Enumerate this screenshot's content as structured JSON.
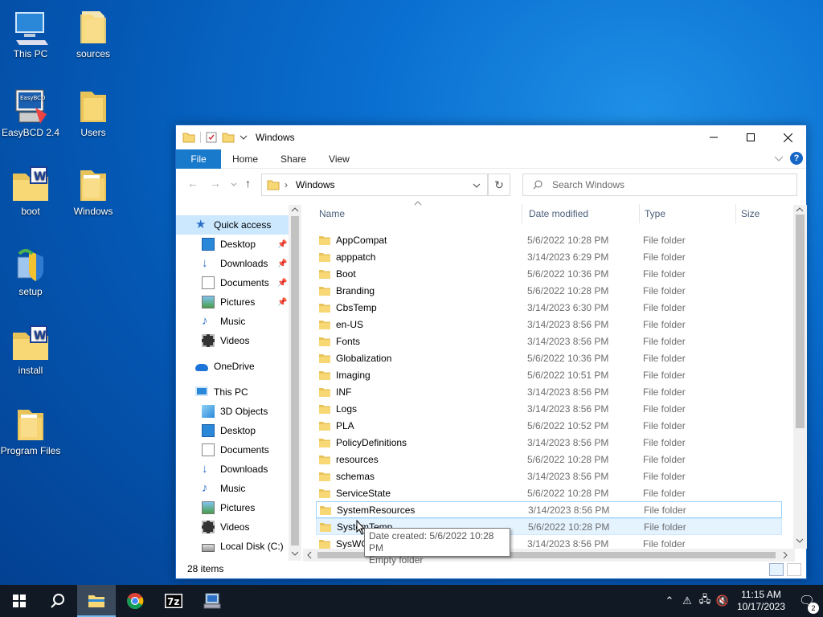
{
  "desktop": {
    "icons": [
      {
        "label": "This PC",
        "icon": "computer-icon"
      },
      {
        "label": "sources",
        "icon": "folder-icon"
      },
      {
        "label": "EasyBCD 2.4",
        "icon": "easybcd-icon"
      },
      {
        "label": "Users",
        "icon": "folder-icon"
      },
      {
        "label": "boot",
        "icon": "wim-folder-icon"
      },
      {
        "label": "Windows",
        "icon": "folder-icon"
      },
      {
        "label": "setup",
        "icon": "setup-icon"
      },
      {
        "label": "install",
        "icon": "wim-folder-icon"
      },
      {
        "label": "Program Files",
        "icon": "folder-icon"
      }
    ],
    "easybcd_badge": "EasyBCD",
    "wim_letter": "W"
  },
  "window": {
    "title": "Windows",
    "ribbon": {
      "file": "File",
      "home": "Home",
      "share": "Share",
      "view": "View",
      "help": "?"
    },
    "address": {
      "path": "Windows",
      "separator": "›"
    },
    "search": {
      "placeholder": "Search Windows"
    },
    "nav": {
      "quick_access": "Quick access",
      "quick_items": [
        "Desktop",
        "Downloads",
        "Documents",
        "Pictures",
        "Music",
        "Videos"
      ],
      "onedrive": "OneDrive",
      "this_pc": "This PC",
      "pc_items": [
        "3D Objects",
        "Desktop",
        "Documents",
        "Downloads",
        "Music",
        "Pictures",
        "Videos",
        "Local Disk (C:)"
      ]
    },
    "columns": {
      "name": "Name",
      "date": "Date modified",
      "type": "Type",
      "size": "Size"
    },
    "files": [
      {
        "name": "AppCompat",
        "date": "5/6/2022 10:28 PM",
        "type": "File folder"
      },
      {
        "name": "apppatch",
        "date": "3/14/2023 6:29 PM",
        "type": "File folder"
      },
      {
        "name": "Boot",
        "date": "5/6/2022 10:36 PM",
        "type": "File folder"
      },
      {
        "name": "Branding",
        "date": "5/6/2022 10:28 PM",
        "type": "File folder"
      },
      {
        "name": "CbsTemp",
        "date": "3/14/2023 6:30 PM",
        "type": "File folder"
      },
      {
        "name": "en-US",
        "date": "3/14/2023 8:56 PM",
        "type": "File folder"
      },
      {
        "name": "Fonts",
        "date": "3/14/2023 8:56 PM",
        "type": "File folder"
      },
      {
        "name": "Globalization",
        "date": "5/6/2022 10:36 PM",
        "type": "File folder"
      },
      {
        "name": "Imaging",
        "date": "5/6/2022 10:51 PM",
        "type": "File folder"
      },
      {
        "name": "INF",
        "date": "3/14/2023 8:56 PM",
        "type": "File folder"
      },
      {
        "name": "Logs",
        "date": "3/14/2023 8:56 PM",
        "type": "File folder"
      },
      {
        "name": "PLA",
        "date": "5/6/2022 10:52 PM",
        "type": "File folder"
      },
      {
        "name": "PolicyDefinitions",
        "date": "3/14/2023 8:56 PM",
        "type": "File folder"
      },
      {
        "name": "resources",
        "date": "5/6/2022 10:28 PM",
        "type": "File folder"
      },
      {
        "name": "schemas",
        "date": "3/14/2023 8:56 PM",
        "type": "File folder"
      },
      {
        "name": "ServiceState",
        "date": "5/6/2022 10:28 PM",
        "type": "File folder"
      },
      {
        "name": "SystemResources",
        "date": "3/14/2023 8:56 PM",
        "type": "File folder"
      },
      {
        "name": "SystemTemp",
        "date": "5/6/2022 10:28 PM",
        "type": "File folder"
      },
      {
        "name": "SysWOW64",
        "date": "3/14/2023 8:56 PM",
        "type": "File folder"
      }
    ],
    "status": {
      "items": "28 items"
    },
    "tooltip": {
      "line1": "Date created: 5/6/2022 10:28 PM",
      "line2": "Empty folder"
    }
  },
  "taskbar": {
    "apps": [
      "start-icon",
      "search-icon",
      "file-explorer-icon",
      "chrome-icon",
      "7zip-icon",
      "network-setup-icon"
    ],
    "seven_zip_label": "7z",
    "clock": {
      "time": "11:15 AM",
      "date": "10/17/2023"
    },
    "notifications": "2"
  },
  "colors": {
    "accent": "#1979ca",
    "selection": "#cce8ff",
    "hover": "#e5f3ff",
    "folder": "#f8d775",
    "taskbar": "#101924"
  }
}
